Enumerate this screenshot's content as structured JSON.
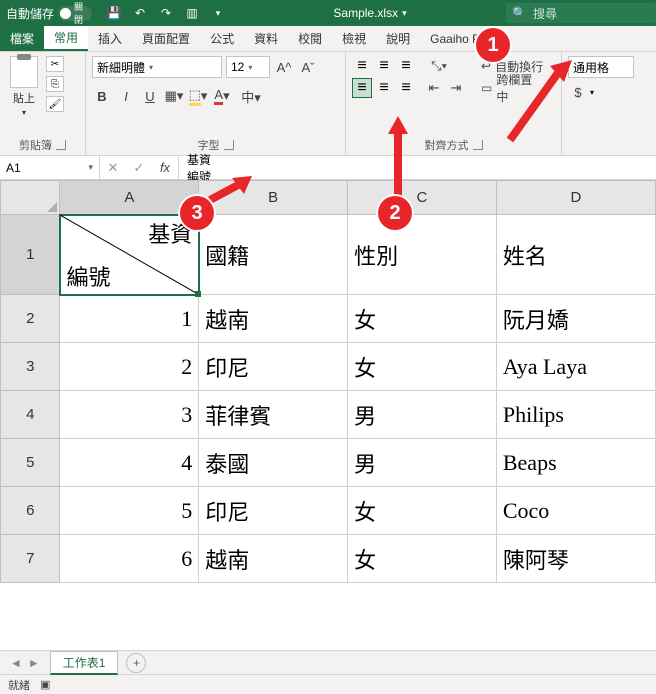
{
  "titlebar": {
    "autosave_label": "自動儲存",
    "autosave_state": "關閉",
    "filename": "Sample.xlsx",
    "search_placeholder": "搜尋"
  },
  "tabs": {
    "file": "檔案",
    "home": "常用",
    "insert": "插入",
    "layout": "頁面配置",
    "formulas": "公式",
    "data": "資料",
    "review": "校閱",
    "view": "檢視",
    "help": "說明",
    "addin": "Gaaiho PD"
  },
  "ribbon": {
    "clipboard": {
      "paste": "貼上",
      "label": "剪貼簿"
    },
    "font": {
      "name": "新細明體",
      "size": "12",
      "label": "字型",
      "bold": "B",
      "italic": "I",
      "underline": "U",
      "phonetic": "中▾"
    },
    "align": {
      "label": "對齊方式",
      "wrap": "自動換行",
      "merge": "跨欄置中"
    },
    "number": {
      "format": "通用格",
      "currency": "$"
    }
  },
  "formula": {
    "name_box": "A1",
    "fx": "fx",
    "value": "基資\n編號"
  },
  "columns": [
    "A",
    "B",
    "C",
    "D"
  ],
  "a1": {
    "top": "基資",
    "bottom": "編號"
  },
  "headers": {
    "b": "國籍",
    "c": "性別",
    "d": "姓名"
  },
  "rows": [
    {
      "n": "1",
      "a": "",
      "b": "越南",
      "c": "女",
      "d": "阮月嬌"
    },
    {
      "n": "2",
      "a": "1",
      "b": "越南",
      "c": "女",
      "d": "阮月嬌"
    },
    {
      "n": "3",
      "a": "2",
      "b": "印尼",
      "c": "女",
      "d": "Aya Laya"
    },
    {
      "n": "4",
      "a": "3",
      "b": "菲律賓",
      "c": "男",
      "d": "Philips"
    },
    {
      "n": "5",
      "a": "4",
      "b": "泰國",
      "c": "男",
      "d": "Beaps"
    },
    {
      "n": "6",
      "a": "5",
      "b": "印尼",
      "c": "女",
      "d": "Coco"
    },
    {
      "n": "7",
      "a": "6",
      "b": "越南",
      "c": "女",
      "d": "陳阿琴"
    }
  ],
  "sheet_tab": "工作表1",
  "status": "就緒",
  "callouts": {
    "c1": "1",
    "c2": "2",
    "c3": "3"
  },
  "chart_data": {
    "type": "table",
    "columns": [
      "編號",
      "國籍",
      "性別",
      "姓名"
    ],
    "records": [
      [
        1,
        "越南",
        "女",
        "阮月嬌"
      ],
      [
        2,
        "印尼",
        "女",
        "Aya Laya"
      ],
      [
        3,
        "菲律賓",
        "男",
        "Philips"
      ],
      [
        4,
        "泰國",
        "男",
        "Beaps"
      ],
      [
        5,
        "印尼",
        "女",
        "Coco"
      ],
      [
        6,
        "越南",
        "女",
        "陳阿琴"
      ]
    ]
  }
}
